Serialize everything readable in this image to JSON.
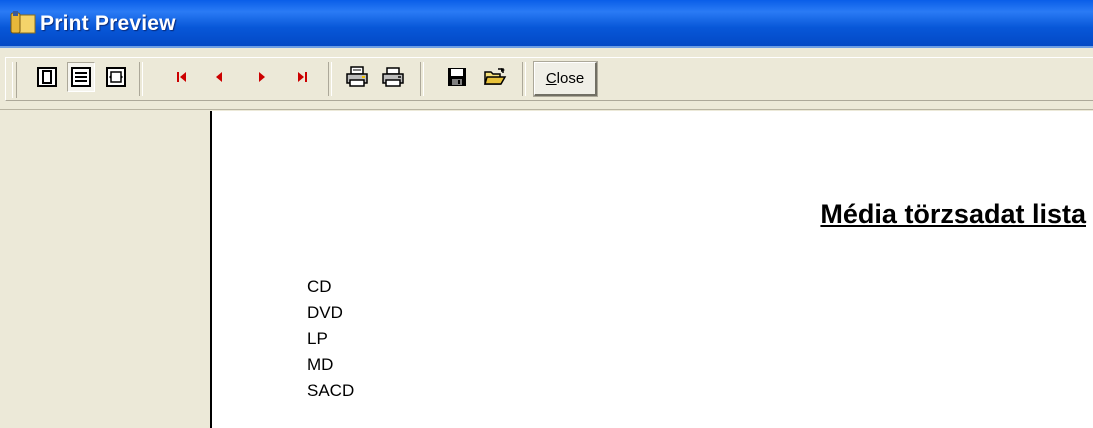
{
  "window": {
    "title": "Print Preview"
  },
  "toolbar": {
    "buttons": [
      {
        "name": "one-page-icon"
      },
      {
        "name": "zoom-icon"
      },
      {
        "name": "page-width-icon"
      },
      {
        "name": "first-page-icon"
      },
      {
        "name": "previous-page-icon"
      },
      {
        "name": "next-page-icon"
      },
      {
        "name": "last-page-icon"
      },
      {
        "name": "print-setup-icon"
      },
      {
        "name": "print-icon"
      },
      {
        "name": "save-icon"
      },
      {
        "name": "open-icon"
      }
    ],
    "close_label_mnemonic": "C",
    "close_label_rest": "lose"
  },
  "report": {
    "title": "Média törzsadat lista",
    "items": [
      "CD",
      "DVD",
      "LP",
      "MD",
      "SACD"
    ]
  },
  "colors": {
    "titlebar": "#0857d8",
    "nav_arrow": "#cc0000",
    "toolbar_bg": "#ece9d8"
  }
}
